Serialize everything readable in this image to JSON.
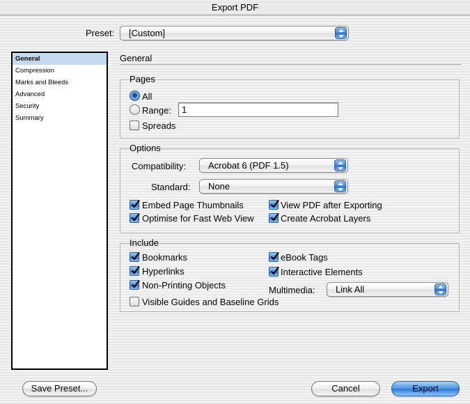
{
  "window": {
    "title": "Export PDF"
  },
  "preset": {
    "label": "Preset:",
    "value": "[Custom]"
  },
  "sidebar": {
    "items": [
      {
        "label": "General",
        "selected": true
      },
      {
        "label": "Compression"
      },
      {
        "label": "Marks and Bleeds"
      },
      {
        "label": "Advanced"
      },
      {
        "label": "Security"
      },
      {
        "label": "Summary"
      }
    ]
  },
  "panel": {
    "title": "General"
  },
  "pages": {
    "title": "Pages",
    "all_label": "All",
    "range_label": "Range:",
    "range_value": "1",
    "spreads_label": "Spreads",
    "selected": "all",
    "spreads_checked": false
  },
  "options": {
    "title": "Options",
    "compatibility_label": "Compatibility:",
    "compatibility_value": "Acrobat 6 (PDF 1.5)",
    "standard_label": "Standard:",
    "standard_value": "None",
    "embed_thumbnails": {
      "label": "Embed Page Thumbnails",
      "checked": true
    },
    "optimise_web": {
      "label": "Optimise for Fast Web View",
      "checked": true
    },
    "view_after": {
      "label": "View PDF after Exporting",
      "checked": true
    },
    "acrobat_layers": {
      "label": "Create Acrobat Layers",
      "checked": true
    }
  },
  "include": {
    "title": "Include",
    "bookmarks": {
      "label": "Bookmarks",
      "checked": true
    },
    "hyperlinks": {
      "label": "Hyperlinks",
      "checked": true
    },
    "non_printing": {
      "label": "Non-Printing Objects",
      "checked": true
    },
    "guides": {
      "label": "Visible Guides and Baseline Grids",
      "checked": false
    },
    "ebook_tags": {
      "label": "eBook Tags",
      "checked": true
    },
    "interactive": {
      "label": "Interactive Elements",
      "checked": true
    },
    "multimedia_label": "Multimedia:",
    "multimedia_value": "Link All"
  },
  "buttons": {
    "save_preset": "Save Preset...",
    "cancel": "Cancel",
    "export": "Export"
  },
  "colors": {
    "accent_blue": "#3479d6",
    "sidebar_selected": "#c4d8ee"
  }
}
